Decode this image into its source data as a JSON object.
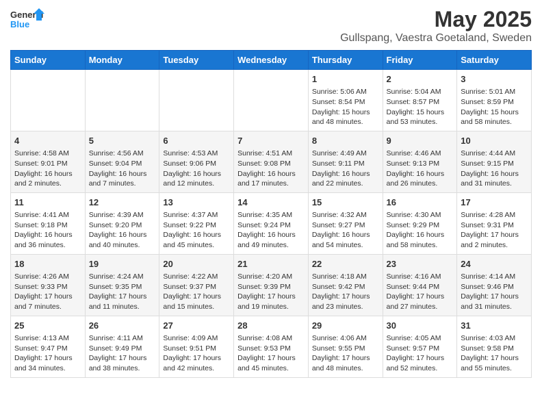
{
  "header": {
    "logo_line1": "General",
    "logo_line2": "Blue",
    "title": "May 2025",
    "subtitle": "Gullspang, Vaestra Goetaland, Sweden"
  },
  "columns": [
    "Sunday",
    "Monday",
    "Tuesday",
    "Wednesday",
    "Thursday",
    "Friday",
    "Saturday"
  ],
  "weeks": [
    {
      "days": [
        {
          "num": "",
          "info": ""
        },
        {
          "num": "",
          "info": ""
        },
        {
          "num": "",
          "info": ""
        },
        {
          "num": "",
          "info": ""
        },
        {
          "num": "1",
          "info": "Sunrise: 5:06 AM\nSunset: 8:54 PM\nDaylight: 15 hours\nand 48 minutes."
        },
        {
          "num": "2",
          "info": "Sunrise: 5:04 AM\nSunset: 8:57 PM\nDaylight: 15 hours\nand 53 minutes."
        },
        {
          "num": "3",
          "info": "Sunrise: 5:01 AM\nSunset: 8:59 PM\nDaylight: 15 hours\nand 58 minutes."
        }
      ]
    },
    {
      "days": [
        {
          "num": "4",
          "info": "Sunrise: 4:58 AM\nSunset: 9:01 PM\nDaylight: 16 hours\nand 2 minutes."
        },
        {
          "num": "5",
          "info": "Sunrise: 4:56 AM\nSunset: 9:04 PM\nDaylight: 16 hours\nand 7 minutes."
        },
        {
          "num": "6",
          "info": "Sunrise: 4:53 AM\nSunset: 9:06 PM\nDaylight: 16 hours\nand 12 minutes."
        },
        {
          "num": "7",
          "info": "Sunrise: 4:51 AM\nSunset: 9:08 PM\nDaylight: 16 hours\nand 17 minutes."
        },
        {
          "num": "8",
          "info": "Sunrise: 4:49 AM\nSunset: 9:11 PM\nDaylight: 16 hours\nand 22 minutes."
        },
        {
          "num": "9",
          "info": "Sunrise: 4:46 AM\nSunset: 9:13 PM\nDaylight: 16 hours\nand 26 minutes."
        },
        {
          "num": "10",
          "info": "Sunrise: 4:44 AM\nSunset: 9:15 PM\nDaylight: 16 hours\nand 31 minutes."
        }
      ]
    },
    {
      "days": [
        {
          "num": "11",
          "info": "Sunrise: 4:41 AM\nSunset: 9:18 PM\nDaylight: 16 hours\nand 36 minutes."
        },
        {
          "num": "12",
          "info": "Sunrise: 4:39 AM\nSunset: 9:20 PM\nDaylight: 16 hours\nand 40 minutes."
        },
        {
          "num": "13",
          "info": "Sunrise: 4:37 AM\nSunset: 9:22 PM\nDaylight: 16 hours\nand 45 minutes."
        },
        {
          "num": "14",
          "info": "Sunrise: 4:35 AM\nSunset: 9:24 PM\nDaylight: 16 hours\nand 49 minutes."
        },
        {
          "num": "15",
          "info": "Sunrise: 4:32 AM\nSunset: 9:27 PM\nDaylight: 16 hours\nand 54 minutes."
        },
        {
          "num": "16",
          "info": "Sunrise: 4:30 AM\nSunset: 9:29 PM\nDaylight: 16 hours\nand 58 minutes."
        },
        {
          "num": "17",
          "info": "Sunrise: 4:28 AM\nSunset: 9:31 PM\nDaylight: 17 hours\nand 2 minutes."
        }
      ]
    },
    {
      "days": [
        {
          "num": "18",
          "info": "Sunrise: 4:26 AM\nSunset: 9:33 PM\nDaylight: 17 hours\nand 7 minutes."
        },
        {
          "num": "19",
          "info": "Sunrise: 4:24 AM\nSunset: 9:35 PM\nDaylight: 17 hours\nand 11 minutes."
        },
        {
          "num": "20",
          "info": "Sunrise: 4:22 AM\nSunset: 9:37 PM\nDaylight: 17 hours\nand 15 minutes."
        },
        {
          "num": "21",
          "info": "Sunrise: 4:20 AM\nSunset: 9:39 PM\nDaylight: 17 hours\nand 19 minutes."
        },
        {
          "num": "22",
          "info": "Sunrise: 4:18 AM\nSunset: 9:42 PM\nDaylight: 17 hours\nand 23 minutes."
        },
        {
          "num": "23",
          "info": "Sunrise: 4:16 AM\nSunset: 9:44 PM\nDaylight: 17 hours\nand 27 minutes."
        },
        {
          "num": "24",
          "info": "Sunrise: 4:14 AM\nSunset: 9:46 PM\nDaylight: 17 hours\nand 31 minutes."
        }
      ]
    },
    {
      "days": [
        {
          "num": "25",
          "info": "Sunrise: 4:13 AM\nSunset: 9:47 PM\nDaylight: 17 hours\nand 34 minutes."
        },
        {
          "num": "26",
          "info": "Sunrise: 4:11 AM\nSunset: 9:49 PM\nDaylight: 17 hours\nand 38 minutes."
        },
        {
          "num": "27",
          "info": "Sunrise: 4:09 AM\nSunset: 9:51 PM\nDaylight: 17 hours\nand 42 minutes."
        },
        {
          "num": "28",
          "info": "Sunrise: 4:08 AM\nSunset: 9:53 PM\nDaylight: 17 hours\nand 45 minutes."
        },
        {
          "num": "29",
          "info": "Sunrise: 4:06 AM\nSunset: 9:55 PM\nDaylight: 17 hours\nand 48 minutes."
        },
        {
          "num": "30",
          "info": "Sunrise: 4:05 AM\nSunset: 9:57 PM\nDaylight: 17 hours\nand 52 minutes."
        },
        {
          "num": "31",
          "info": "Sunrise: 4:03 AM\nSunset: 9:58 PM\nDaylight: 17 hours\nand 55 minutes."
        }
      ]
    }
  ]
}
